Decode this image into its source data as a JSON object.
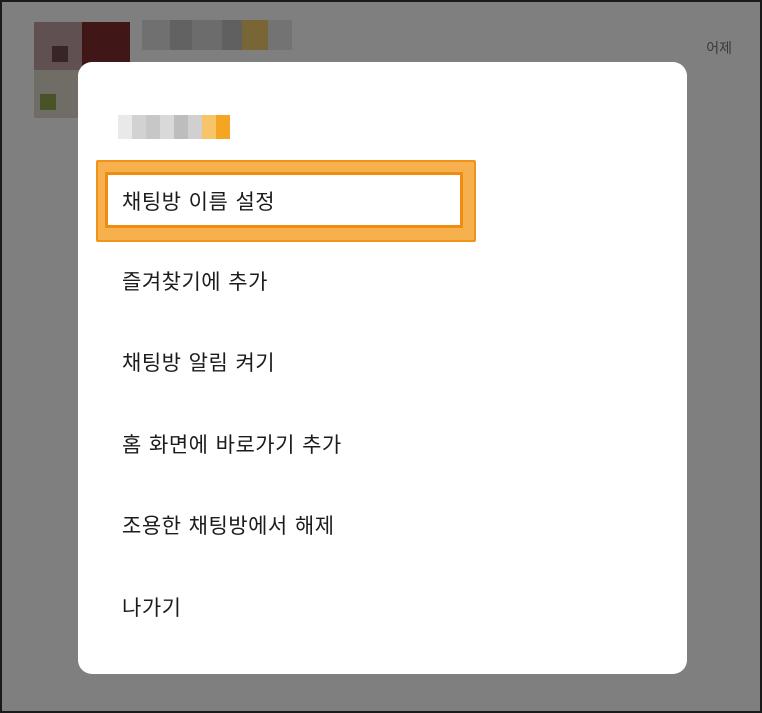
{
  "background": {
    "chat_row": {
      "time": "어제"
    }
  },
  "dialog": {
    "menu": [
      {
        "label": "채팅방 이름 설정",
        "highlighted": true
      },
      {
        "label": "즐겨찾기에 추가"
      },
      {
        "label": "채팅방 알림 켜기"
      },
      {
        "label": "홈 화면에 바로가기 추가"
      },
      {
        "label": "조용한 채팅방에서 해제"
      },
      {
        "label": "나가기"
      }
    ]
  },
  "colors": {
    "highlight_fill": "#f6b04d",
    "highlight_border": "#ef8d10",
    "overlay": "rgba(0,0,0,0.48)"
  }
}
